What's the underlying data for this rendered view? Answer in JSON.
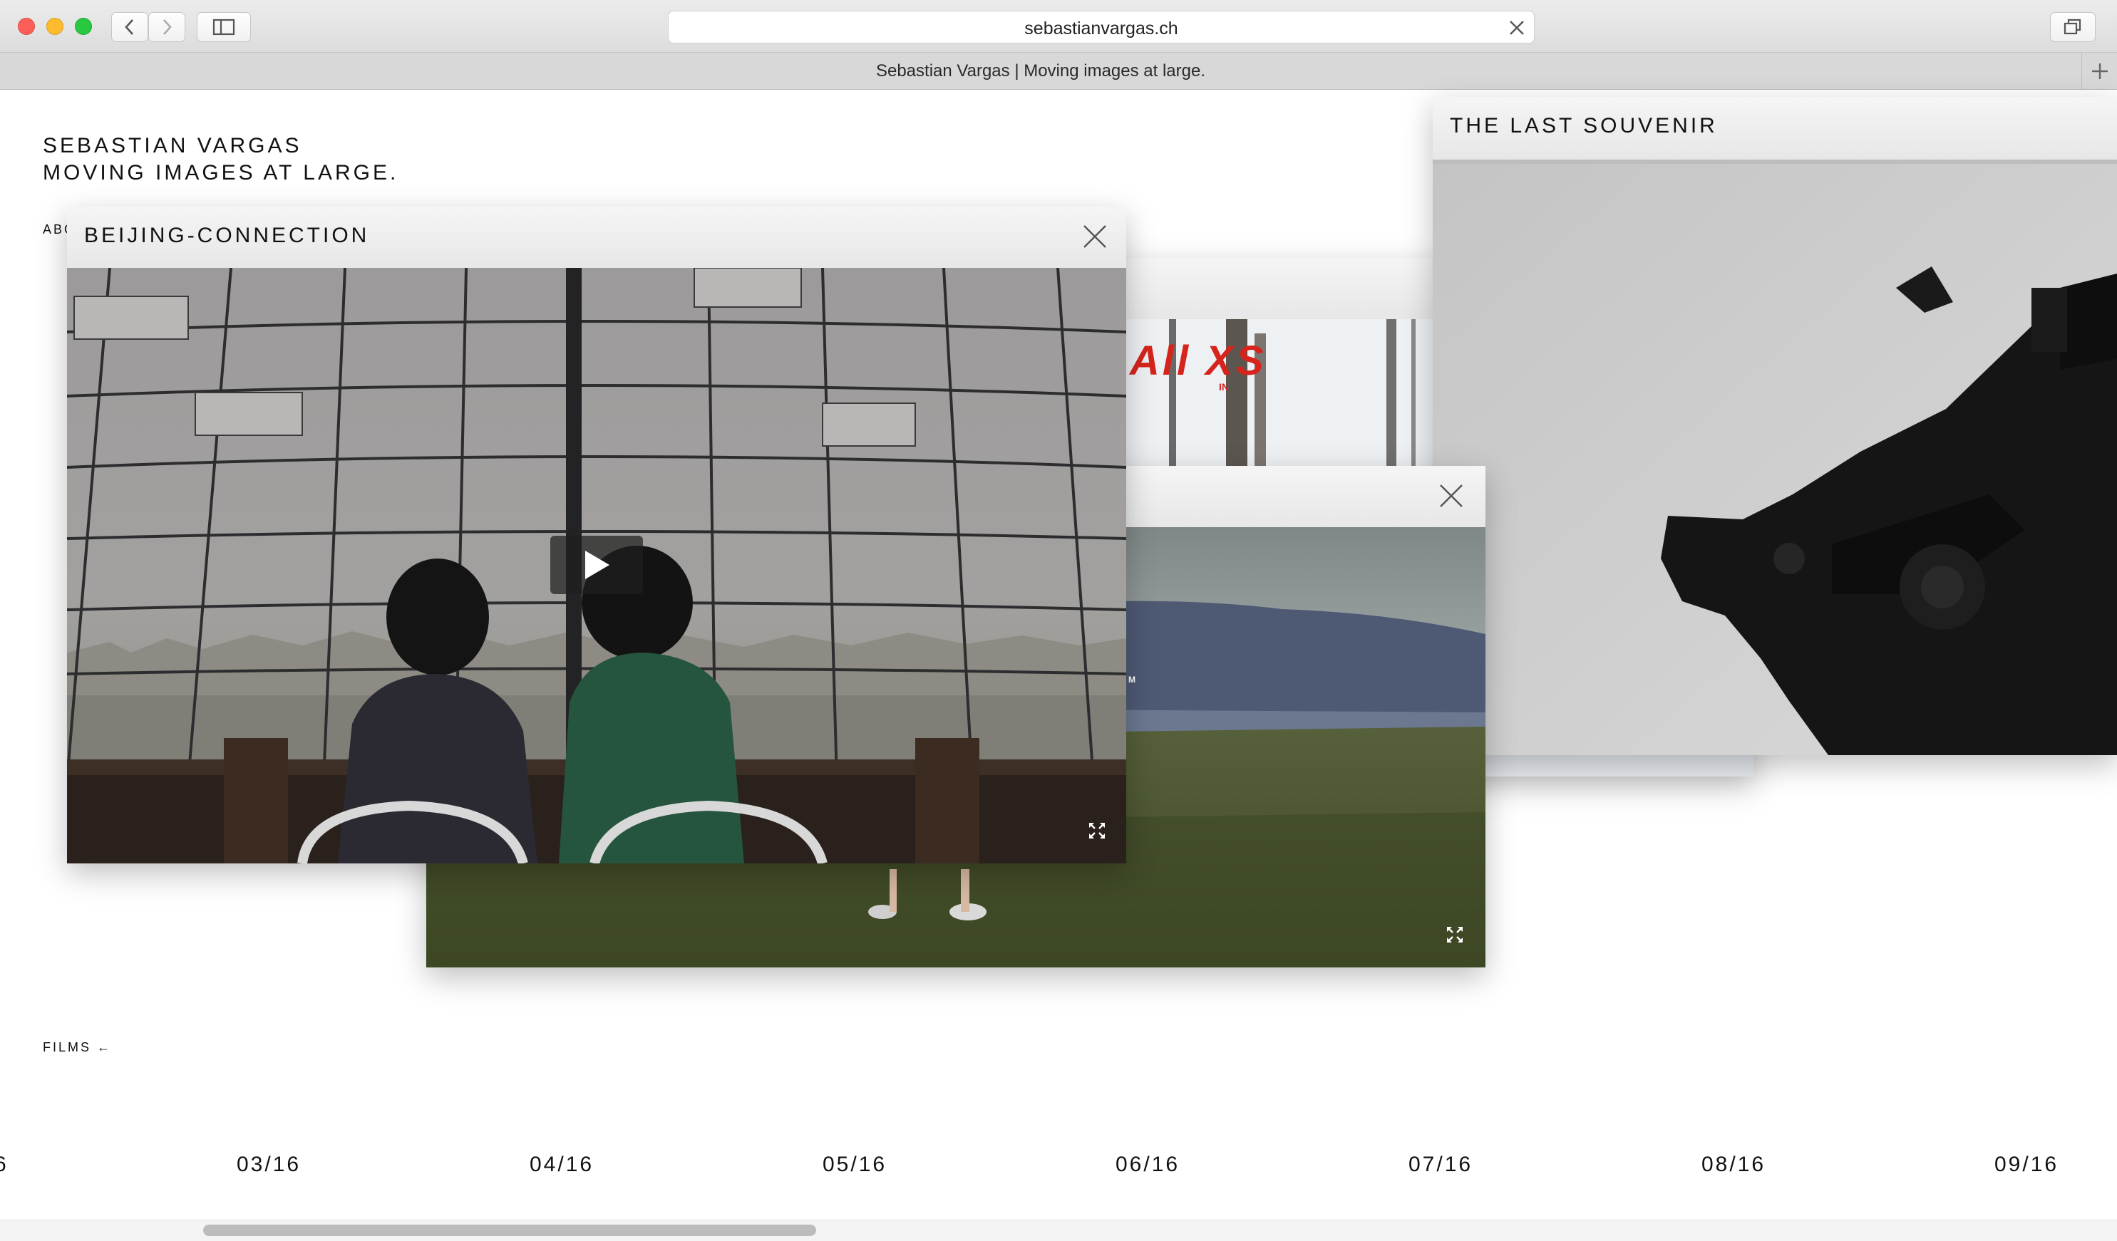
{
  "browser": {
    "url": "sebastianvargas.ch",
    "tab_title": "Sebastian Vargas | Moving images at large.",
    "icons": [
      "back-icon",
      "forward-icon",
      "sidebar-icon",
      "clear-icon",
      "tabs-overview-icon",
      "new-tab-icon"
    ]
  },
  "site": {
    "title_line1": "SEBASTIAN VARGAS",
    "title_line2": "MOVING IMAGES AT LARGE.",
    "about_label": "ABOUT ←",
    "films_label": "FILMS ←"
  },
  "windows": {
    "beijing": {
      "title": "BEIJING-CONNECTION"
    },
    "souvenir": {
      "title": "THE LAST SOUVENIR"
    },
    "allxs": {
      "overlay_text": "All XS",
      "small_text": "IN"
    },
    "landscape": {
      "caption_glyph": "M"
    }
  },
  "timeline": {
    "months": [
      "6",
      "03/16",
      "04/16",
      "05/16",
      "06/16",
      "07/16",
      "08/16",
      "09/16"
    ]
  }
}
